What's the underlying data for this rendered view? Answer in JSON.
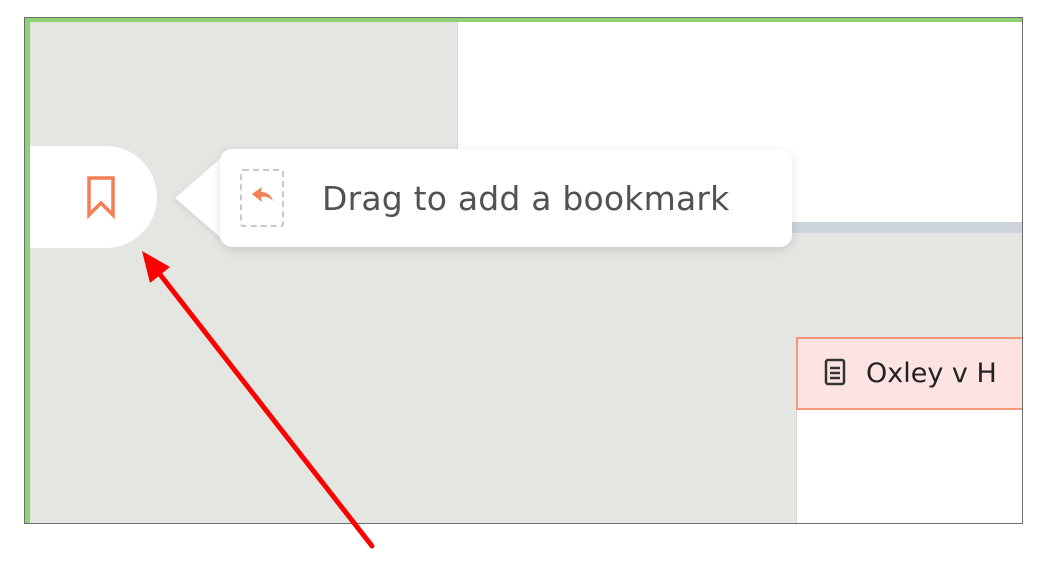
{
  "colors": {
    "accent_green": "#8fd173",
    "bookmark_orange": "#f47f55",
    "doc_highlight_bg": "#fde4e2",
    "doc_highlight_border": "#f7967a",
    "annotation_arrow": "#ff0000",
    "sidebar_bg": "#e3e6e1"
  },
  "bookmark_tab": {
    "icon": "bookmark-icon"
  },
  "tooltip": {
    "text": "Drag to add a bookmark",
    "drag_icon": "drag-arrow-icon"
  },
  "document": {
    "icon": "document-icon",
    "title": "Oxley v H"
  },
  "annotation": {
    "type": "arrow",
    "points_to": "bookmark-tab"
  }
}
